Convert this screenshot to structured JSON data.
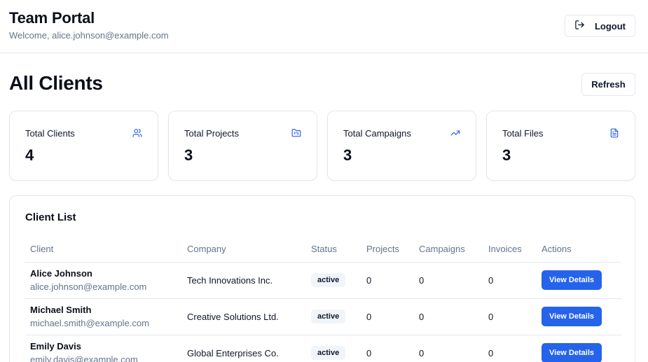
{
  "header": {
    "title": "Team Portal",
    "welcome": "Welcome, alice.johnson@example.com",
    "logout_label": "Logout",
    "logout_icon": "logout-icon"
  },
  "page": {
    "title": "All Clients",
    "refresh_label": "Refresh"
  },
  "stats": [
    {
      "label": "Total Clients",
      "value": "4",
      "icon": "users-icon"
    },
    {
      "label": "Total Projects",
      "value": "3",
      "icon": "folder-kanban-icon"
    },
    {
      "label": "Total Campaigns",
      "value": "3",
      "icon": "trending-up-icon"
    },
    {
      "label": "Total Files",
      "value": "3",
      "icon": "file-text-icon"
    }
  ],
  "client_list": {
    "title": "Client List",
    "columns": [
      "Client",
      "Company",
      "Status",
      "Projects",
      "Campaigns",
      "Invoices",
      "Actions"
    ],
    "rows": [
      {
        "name": "Alice Johnson",
        "email": "alice.johnson@example.com",
        "company": "Tech Innovations Inc.",
        "status": "active",
        "projects": "0",
        "campaigns": "0",
        "invoices": "0",
        "action": "View Details"
      },
      {
        "name": "Michael Smith",
        "email": "michael.smith@example.com",
        "company": "Creative Solutions Ltd.",
        "status": "active",
        "projects": "0",
        "campaigns": "0",
        "invoices": "0",
        "action": "View Details"
      },
      {
        "name": "Emily Davis",
        "email": "emily.davis@example.com",
        "company": "Global Enterprises Co.",
        "status": "active",
        "projects": "0",
        "campaigns": "0",
        "invoices": "0",
        "action": "View Details"
      }
    ]
  },
  "colors": {
    "accent": "#2563eb",
    "muted_text": "#64748b",
    "border": "#e2e8f0",
    "badge_bg": "#f1f5f9"
  }
}
